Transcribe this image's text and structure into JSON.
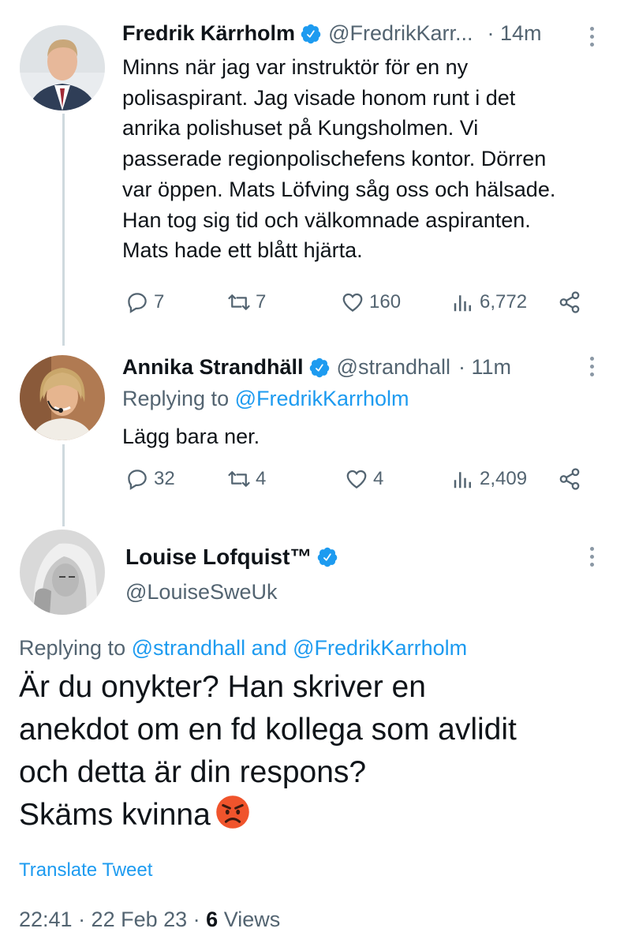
{
  "tweets": [
    {
      "name": "Fredrik Kärrholm",
      "handle": "@FredrikKarr...",
      "time": "· 14m",
      "text_lines": [
        "Minns när jag var instruktör för en ny",
        "polisaspirant. Jag visade honom runt i det",
        "anrika polishuset på Kungsholmen. Vi",
        "passerade regionpolischefens kontor. Dörren",
        "var öppen. Mats Löfving såg oss och hälsade.",
        "Han tog sig tid och välkomnade aspiranten.",
        "Mats hade ett blått hjärta."
      ],
      "replies": "7",
      "retweets": "7",
      "likes": "160",
      "views": "6,772"
    },
    {
      "name": "Annika Strandhäll",
      "handle": "@strandhall",
      "time": "· 11m",
      "replying_prefix": "Replying to ",
      "replying_to": "@FredrikKarrholm",
      "text": "Lägg bara ner.",
      "replies": "32",
      "retweets": "4",
      "likes": "4",
      "views": "2,409"
    }
  ],
  "main_tweet": {
    "name": "Louise Lofquist™",
    "handle": "@LouiseSweUk",
    "replying_prefix": "Replying to ",
    "replying_to_1": "@strandhall",
    "replying_and": " and ",
    "replying_to_2": "@FredrikKarrholm",
    "text_lines": [
      "Är du onykter? Han skriver en",
      "anekdot om en fd kollega som avlidit",
      "och detta är din respons?",
      "Skäms kvinna"
    ],
    "emoji": "angry-face",
    "translate": "Translate Tweet",
    "time": "22:41 · 22 Feb 23 · ",
    "views_count": "6",
    "views_label": " Views"
  },
  "colors": {
    "accent": "#1d9bf0",
    "secondary_text": "#536471",
    "thread_line": "#cfd9de"
  }
}
